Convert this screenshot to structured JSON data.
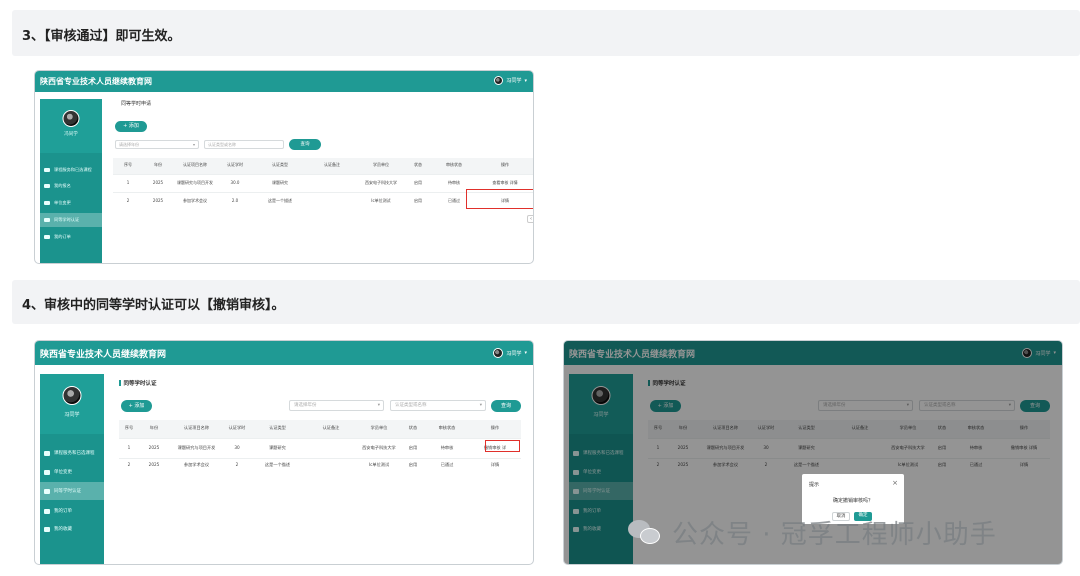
{
  "step3": {
    "text": "3、【审核通过】即可生效。"
  },
  "step4": {
    "text": "4、审核中的同等学时认证可以【撤销审核】。"
  },
  "app": {
    "site_title": "陕西省专业技术人员继续教育网",
    "user_name": "冯同学",
    "user_caret": "▾"
  },
  "shot1": {
    "sidebar_name": "冯同学",
    "sidebar_items": [
      "课程服务和已选课程",
      "我的报名",
      "单位变更",
      "同等学时认证",
      "我的订单"
    ],
    "active_item": 3,
    "page_title": "同等学时申请",
    "add_label": "+ 添加",
    "filter1_placeholder": "请选择年份",
    "filter2_placeholder": "认证类型或名称",
    "query_label": "查询",
    "columns": [
      "序号",
      "年份",
      "认证项目名称",
      "认证学时",
      "认证类型",
      "认证备注",
      "学员单位",
      "状态",
      "审核状态",
      "操作"
    ],
    "rows": [
      [
        "1",
        "2025",
        "课题研究与项目开发",
        "30.0",
        "课题研究",
        "",
        "西安电子科技大学",
        "启用",
        "待审核",
        "查看审核  详情"
      ],
      [
        "2",
        "2025",
        "参加学术会议",
        "2.0",
        "这是一个描述",
        "",
        "Ic单位测试",
        "启用",
        "已通过",
        "详情"
      ]
    ],
    "pager": [
      "‹",
      "1",
      "›"
    ]
  },
  "shot2": {
    "sidebar_name": "冯同学",
    "sidebar_items": [
      "课程服务和已选课程",
      "单位变更",
      "同等学时认证",
      "我的订单",
      "我的收藏"
    ],
    "active_item": 2,
    "page_title": "同等学时认证",
    "add_label": "+ 添加",
    "filter1_placeholder": "请选择年份",
    "filter2_placeholder": "认证类型或名称",
    "query_label": "查询",
    "columns": [
      "序号",
      "年份",
      "认证项目名称",
      "认证学时",
      "认证类型",
      "认证备注",
      "学员单位",
      "状态",
      "审核状态",
      "操作"
    ],
    "rows": [
      [
        "1",
        "2025",
        "课题研究与项目开发",
        "30",
        "课题研究",
        "",
        "西安电子科技大学",
        "启用",
        "待审核",
        "撤销审核  详"
      ],
      [
        "2",
        "2025",
        "参加学术会议",
        "2",
        "这是一个描述",
        "",
        "Ic单位测试",
        "启用",
        "已通过",
        "详情"
      ]
    ]
  },
  "shot3": {
    "sidebar_name": "冯同学",
    "sidebar_items": [
      "课程服务和已选课程",
      "单位变更",
      "同等学时认证",
      "我的订单",
      "我的收藏"
    ],
    "active_item": 2,
    "page_title": "同等学时认证",
    "add_label": "+ 添加",
    "filter1_placeholder": "请选择年份",
    "filter2_placeholder": "认证类型或名称",
    "query_label": "查询",
    "columns": [
      "序号",
      "年份",
      "认证项目名称",
      "认证学时",
      "认证类型",
      "认证备注",
      "学员单位",
      "状态",
      "审核状态",
      "操作"
    ],
    "rows": [
      [
        "1",
        "2025",
        "课题研究与项目开发",
        "30",
        "课题研究",
        "",
        "西安电子科技大学",
        "启用",
        "待审核",
        "撤销审核  详情"
      ],
      [
        "2",
        "2025",
        "参加学术会议",
        "2",
        "这是一个描述",
        "",
        "Ic单位测试",
        "启用",
        "已通过",
        "详情"
      ]
    ],
    "dialog": {
      "title": "提示",
      "message": "确定撤销审核吗？",
      "cancel_label": "取消",
      "ok_label": "确定",
      "close_label": "×"
    }
  },
  "watermark": {
    "text": "公众号 · 冠孚工程师小助手"
  },
  "colors": {
    "teal": "#1f9a94",
    "pending": "#f39c12",
    "passed": "#27a844",
    "link": "#2f6fd0",
    "highlight": "#e0302b"
  }
}
